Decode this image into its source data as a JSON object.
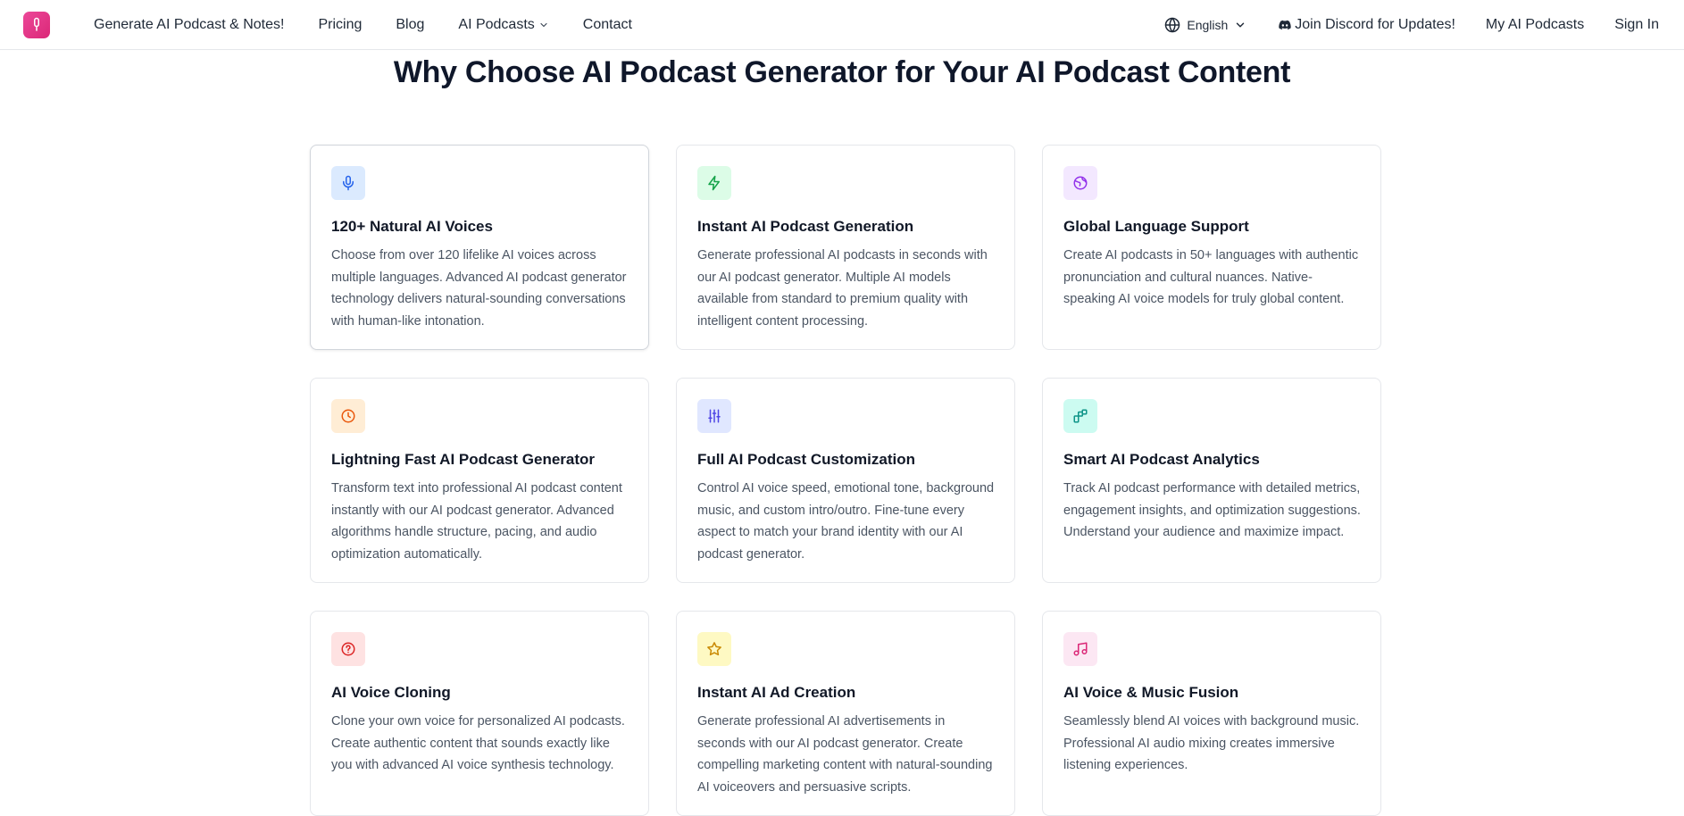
{
  "nav": {
    "links": [
      "Generate AI Podcast & Notes!",
      "Pricing",
      "Blog"
    ],
    "podcasts_label": "AI Podcasts",
    "contact_label": "Contact",
    "language": "English",
    "discord_label": "Join Discord for Updates!",
    "my_podcasts_label": "My AI Podcasts",
    "sign_in_label": "Sign In"
  },
  "heading": "Why Choose AI Podcast Generator for Your AI Podcast Content",
  "features": [
    {
      "icon": "microphone-icon",
      "bg": "#dbeafe",
      "color": "#2563eb",
      "title": "120+ Natural AI Voices",
      "desc": "Choose from over 120 lifelike AI voices across multiple languages. Advanced AI podcast generator technology delivers natural-sounding conversations with human-like intonation."
    },
    {
      "icon": "lightning-icon",
      "bg": "#dcfce7",
      "color": "#16a34a",
      "title": "Instant AI Podcast Generation",
      "desc": "Generate professional AI podcasts in seconds with our AI podcast generator. Multiple AI models available from standard to premium quality with intelligent content processing."
    },
    {
      "icon": "globe-icon",
      "bg": "#f3e8ff",
      "color": "#9333ea",
      "title": "Global Language Support",
      "desc": "Create AI podcasts in 50+ languages with authentic pronunciation and cultural nuances. Native-speaking AI voice models for truly global content."
    },
    {
      "icon": "clock-icon",
      "bg": "#ffedd5",
      "color": "#ea580c",
      "title": "Lightning Fast AI Podcast Generator",
      "desc": "Transform text into professional AI podcast content instantly with our AI podcast generator. Advanced algorithms handle structure, pacing, and audio optimization automatically."
    },
    {
      "icon": "sliders-icon",
      "bg": "#e0e7ff",
      "color": "#4f46e5",
      "title": "Full AI Podcast Customization",
      "desc": "Control AI voice speed, emotional tone, background music, and custom intro/outro. Fine-tune every aspect to match your brand identity with our AI podcast generator."
    },
    {
      "icon": "analytics-icon",
      "bg": "#ccfbf1",
      "color": "#0d9488",
      "title": "Smart AI Podcast Analytics",
      "desc": "Track AI podcast performance with detailed metrics, engagement insights, and optimization suggestions. Understand your audience and maximize impact."
    },
    {
      "icon": "voice-clone-icon",
      "bg": "#fee2e2",
      "color": "#dc2626",
      "title": "AI Voice Cloning",
      "desc": "Clone your own voice for personalized AI podcasts. Create authentic content that sounds exactly like you with advanced AI voice synthesis technology."
    },
    {
      "icon": "star-icon",
      "bg": "#fef9c3",
      "color": "#ca8a04",
      "title": "Instant AI Ad Creation",
      "desc": "Generate professional AI advertisements in seconds with our AI podcast generator. Create compelling marketing content with natural-sounding AI voiceovers and persuasive scripts."
    },
    {
      "icon": "music-note-icon",
      "bg": "#fce7f3",
      "color": "#db2777",
      "title": "AI Voice & Music Fusion",
      "desc": "Seamlessly blend AI voices with background music. Professional AI audio mixing creates immersive listening experiences."
    }
  ]
}
